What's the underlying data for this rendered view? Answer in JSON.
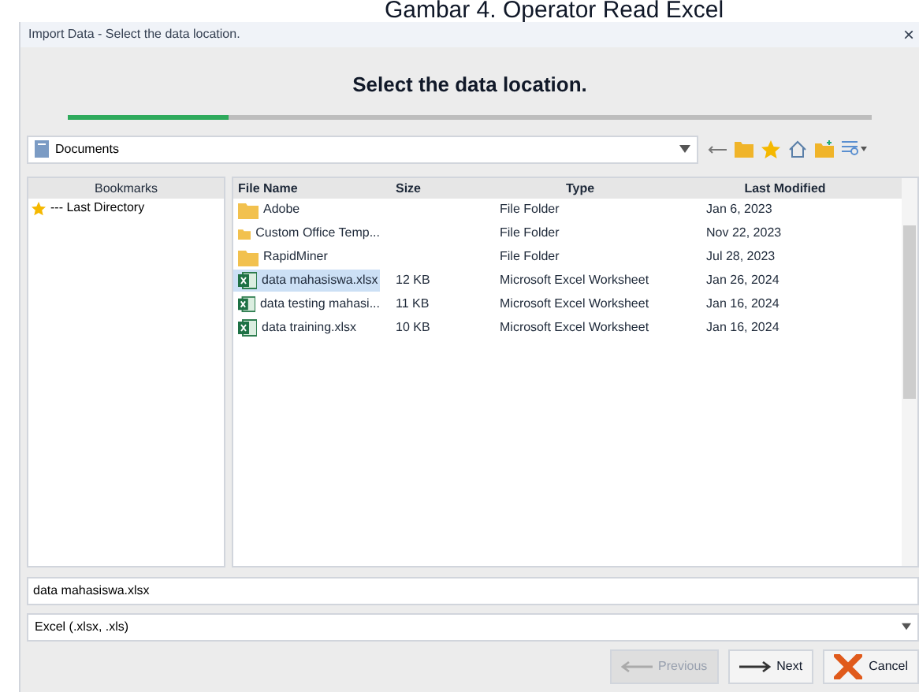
{
  "caption": "Gambar 4. Operator Read Excel",
  "window": {
    "title": "Import Data - Select the data location.",
    "close": "×"
  },
  "header": {
    "title": "Select the data location.",
    "progress": {
      "level": 0.2
    }
  },
  "location": {
    "value": "Documents"
  },
  "bookmarks": {
    "heading": "Bookmarks",
    "items": [
      {
        "label": "--- Last Directory",
        "selected": false
      }
    ]
  },
  "files": {
    "columns": [
      "File Name",
      "Size",
      "Type",
      "Last Modified"
    ],
    "rows": [
      {
        "kind": "folder",
        "name": "Adobe",
        "size": "",
        "type": "File Folder",
        "modified": "Jan 6, 2023",
        "selected": false
      },
      {
        "kind": "folder",
        "name": "Custom Office Temp...",
        "size": "",
        "type": "File Folder",
        "modified": "Nov 22, 2023",
        "selected": false
      },
      {
        "kind": "folder",
        "name": "RapidMiner",
        "size": "",
        "type": "File Folder",
        "modified": "Jul 28, 2023",
        "selected": false
      },
      {
        "kind": "excel",
        "name": "data mahasiswa.xlsx",
        "size": "12 KB",
        "type": "Microsoft Excel Worksheet",
        "modified": "Jan 26, 2024",
        "selected": true
      },
      {
        "kind": "excel",
        "name": "data testing mahasi...",
        "size": "11 KB",
        "type": "Microsoft Excel Worksheet",
        "modified": "Jan 16, 2024",
        "selected": false
      },
      {
        "kind": "excel",
        "name": "data training.xlsx",
        "size": "10 KB",
        "type": "Microsoft Excel Worksheet",
        "modified": "Jan 16, 2024",
        "selected": false
      }
    ]
  },
  "filename": {
    "value": "data mahasiswa.xlsx"
  },
  "filter": {
    "value": "Excel (.xlsx, .xls)"
  },
  "buttons": [
    {
      "label": "Previous",
      "disabled": true,
      "kind": "previous"
    },
    {
      "label": "Next",
      "disabled": false,
      "kind": "next"
    },
    {
      "label": "Cancel",
      "disabled": false,
      "kind": "cancel"
    }
  ]
}
